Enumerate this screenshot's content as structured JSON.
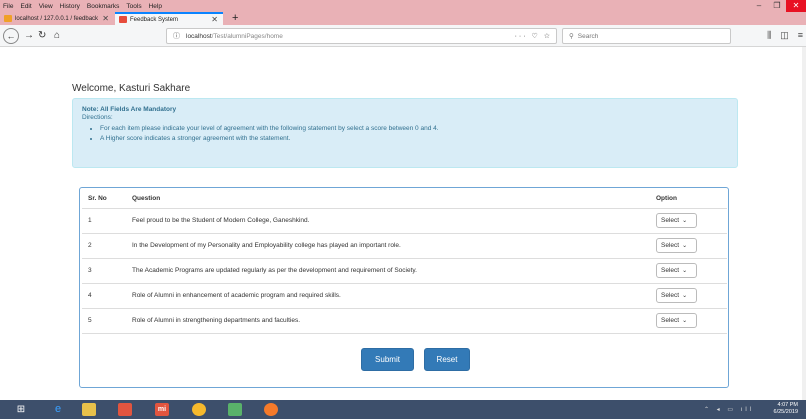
{
  "browser": {
    "menu": [
      "File",
      "Edit",
      "View",
      "History",
      "Bookmarks",
      "Tools",
      "Help"
    ],
    "tabs": [
      {
        "label": "localhost / 127.0.0.1 / feedback",
        "active": false
      },
      {
        "label": "Feedback System",
        "active": true
      }
    ],
    "url_host": "localhost",
    "url_path": "/Test/alumniPages/home",
    "search_placeholder": "Search",
    "url_actions": "··· ♡ ☆"
  },
  "page": {
    "welcome": "Welcome, Kasturi Sakhare",
    "alert": {
      "note": "Note: All Fields Are Mandatory",
      "directions_label": "Directions:",
      "points": [
        "For each item please indicate your level of agreement with the following statement by select a score between 0 and 4.",
        "A Higher score indicates a stronger agreement with the statement."
      ]
    },
    "table": {
      "headers": [
        "Sr. No",
        "Question",
        "Option"
      ],
      "rows": [
        {
          "sr": "1",
          "question": "Feel proud to be the Student of Modern College, Ganeshkind.",
          "option": "Select"
        },
        {
          "sr": "2",
          "question": "In the Development of my Personality and Employability college has played an important role.",
          "option": "Select"
        },
        {
          "sr": "3",
          "question": "The Academic Programs are updated regularly as per the development and requirement of Society.",
          "option": "Select"
        },
        {
          "sr": "4",
          "question": "Role of Alumni in enhancement of academic program and required skills.",
          "option": "Select"
        },
        {
          "sr": "5",
          "question": "Role of Alumni in strengthening departments and faculties.",
          "option": "Select"
        }
      ]
    },
    "submit_label": "Submit",
    "reset_label": "Reset"
  },
  "taskbar": {
    "time": "4:07 PM",
    "date": "6/25/2019"
  },
  "colors": {
    "accent": "#337ab7",
    "alert_bg": "#d9edf7",
    "titlebar": "#e9b1b6",
    "taskbar": "#3d4f6b"
  }
}
